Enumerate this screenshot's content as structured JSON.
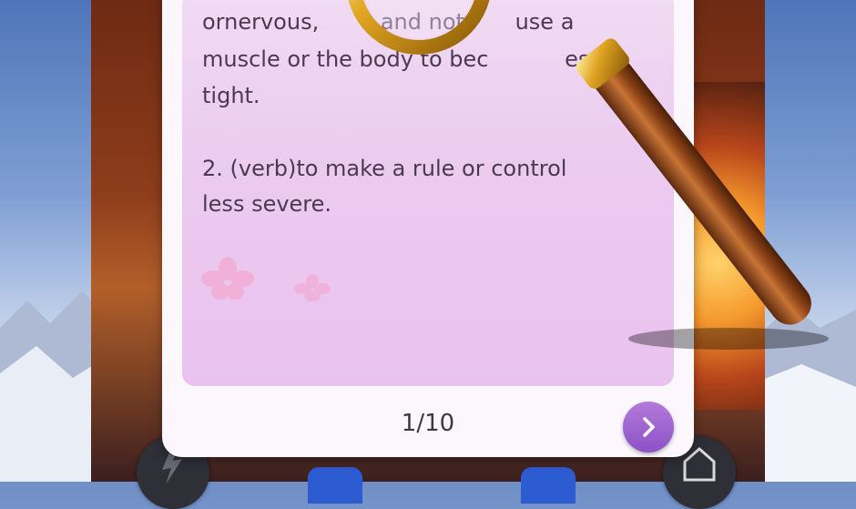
{
  "definition": {
    "lines": [
      "ornervous,",
      "and not",
      "use a",
      "muscle or the body to bec",
      "ess",
      "tight.",
      "2. (verb)to make a rule or control",
      "less severe."
    ]
  },
  "pager": {
    "counter": "1/10"
  },
  "icons": {
    "next": "chevron-right-icon",
    "hint": "lightning-icon",
    "shop": "house-icon",
    "magnifier": "magnifying-glass-icon"
  },
  "colors": {
    "panel": "#ecccf0",
    "text": "#4b3a52",
    "next_button": "#9a62cf"
  }
}
